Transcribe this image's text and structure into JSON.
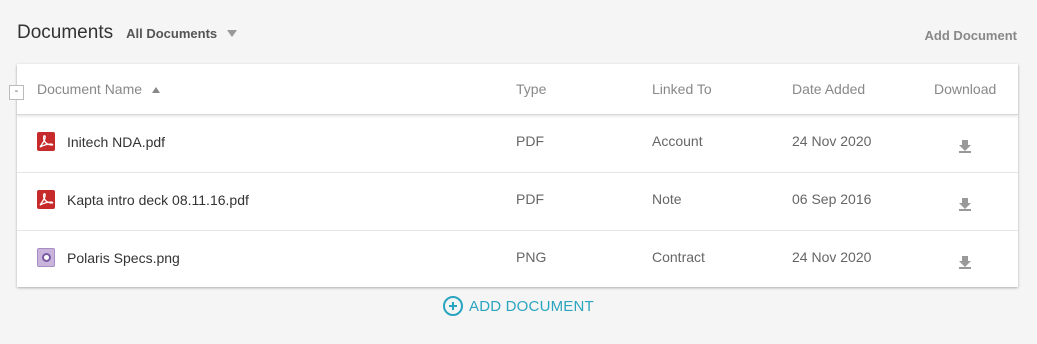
{
  "header": {
    "title": "Documents",
    "filter_label": "All Documents",
    "add_link": "Add Document"
  },
  "table": {
    "collapse_symbol": "-",
    "columns": {
      "name": "Document Name",
      "type": "Type",
      "linked": "Linked To",
      "date": "Date Added",
      "download": "Download"
    },
    "sort": {
      "column": "name",
      "direction": "asc"
    },
    "rows": [
      {
        "name": "Initech NDA.pdf",
        "icon": "pdf-file-icon",
        "type": "PDF",
        "linked": "Account",
        "date": "24 Nov 2020"
      },
      {
        "name": "Kapta intro deck 08.11.16.pdf",
        "icon": "pdf-file-icon",
        "type": "PDF",
        "linked": "Note",
        "date": "06 Sep 2016"
      },
      {
        "name": "Polaris Specs.png",
        "icon": "image-file-icon",
        "type": "PNG",
        "linked": "Contract",
        "date": "24 Nov 2020"
      }
    ]
  },
  "footer": {
    "add_button": "ADD DOCUMENT"
  },
  "colors": {
    "accent": "#2aa5bf",
    "pdf_icon": "#c62a2a",
    "image_icon": "#c9b5dc",
    "background": "#f5f5f5"
  }
}
